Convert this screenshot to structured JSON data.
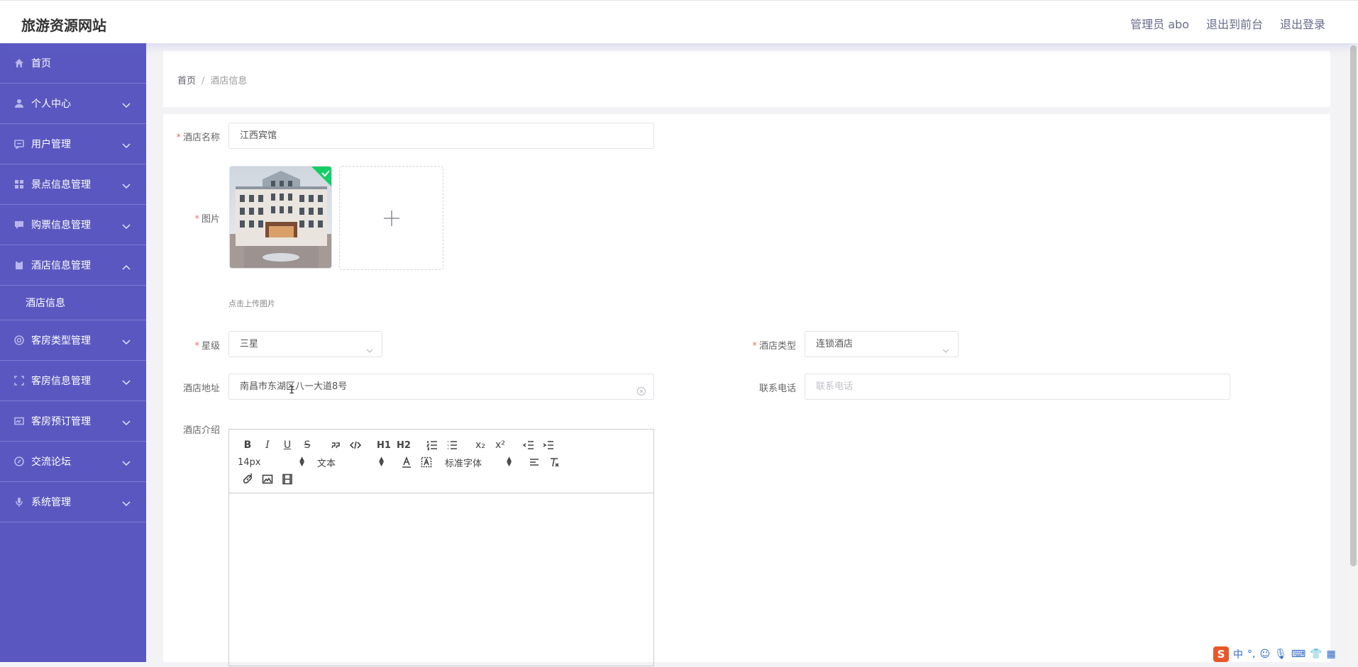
{
  "header": {
    "site_title": "旅游资源网站",
    "admin_label": "管理员 abo",
    "back_to_front": "退出到前台",
    "logout": "退出登录"
  },
  "sidebar": {
    "items": [
      {
        "label": "首页",
        "icon": "home-icon"
      },
      {
        "label": "个人中心",
        "icon": "user-icon"
      },
      {
        "label": "用户管理",
        "icon": "message-icon"
      },
      {
        "label": "景点信息管理",
        "icon": "grid-icon"
      },
      {
        "label": "购票信息管理",
        "icon": "chat-icon"
      },
      {
        "label": "酒店信息管理",
        "icon": "clipboard-icon",
        "expanded": true
      },
      {
        "label": "客房类型管理",
        "icon": "lifebuoy-icon"
      },
      {
        "label": "客房信息管理",
        "icon": "frame-icon"
      },
      {
        "label": "客房预订管理",
        "icon": "card-icon"
      },
      {
        "label": "交流论坛",
        "icon": "compass-icon"
      },
      {
        "label": "系统管理",
        "icon": "mic-icon"
      }
    ],
    "sub_item": "酒店信息"
  },
  "breadcrumb": {
    "home": "首页",
    "separator": "/",
    "current": "酒店信息"
  },
  "form": {
    "name_label": "酒店名称",
    "name_value": "江西宾馆",
    "image_label": "图片",
    "upload_tip": "点击上传图片",
    "star_label": "星级",
    "star_value": "三星",
    "type_label": "酒店类型",
    "type_value": "连锁酒店",
    "address_label": "酒店地址",
    "address_value": "南昌市东湖区八一大道8号",
    "phone_label": "联系电话",
    "phone_placeholder": "联系电话",
    "intro_label": "酒店介绍",
    "required_mark": "*"
  },
  "editor": {
    "font_size": "14px",
    "block_format": "文本",
    "font_family": "标准字体",
    "buttons_row1": [
      "B",
      "I",
      "U",
      "S",
      "quote",
      "code",
      "H1",
      "H2",
      "ol",
      "ul",
      "x₂",
      "x²",
      "outdent",
      "indent"
    ]
  },
  "ime": {
    "logo": "S",
    "mode": "中"
  },
  "colors": {
    "sidebar_bg": "#5a58c0",
    "accent": "#5a58c0",
    "success": "#13ce66",
    "required": "#f56c6c"
  }
}
